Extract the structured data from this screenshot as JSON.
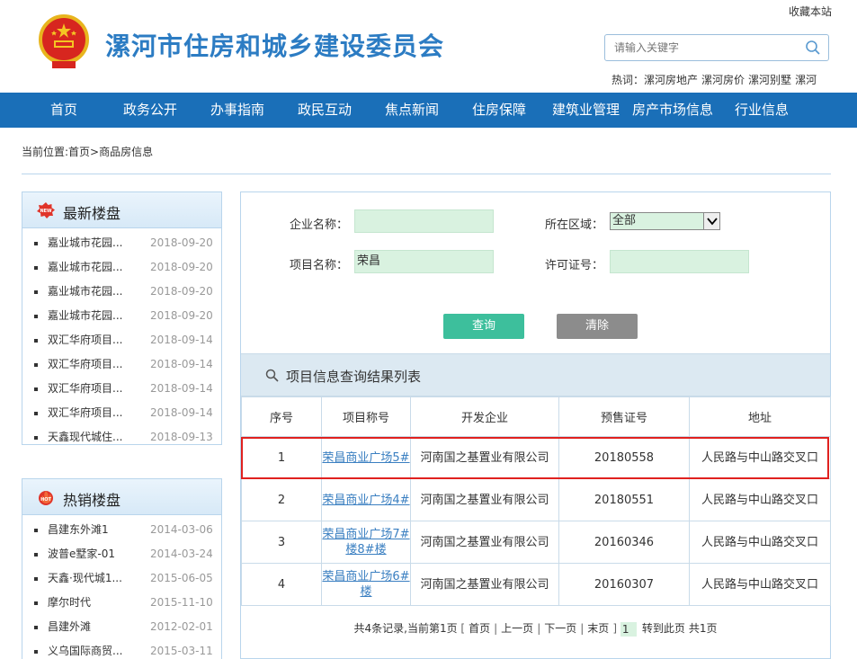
{
  "header": {
    "favorite_label": "收藏本站",
    "site_title": "漯河市住房和城乡建设委员会",
    "search_placeholder": "请输入关键字",
    "hot_label": "热词：",
    "hot_words": [
      "漯河房地产",
      "漯河房价",
      "漯河别墅",
      "漯河"
    ]
  },
  "nav": {
    "items": [
      "首页",
      "政务公开",
      "办事指南",
      "政民互动",
      "焦点新闻",
      "住房保障",
      "建筑业管理",
      "房产市场信息",
      "行业信息"
    ]
  },
  "breadcrumb": "当前位置:首页>商品房信息",
  "sidebar": {
    "latest": {
      "title": "最新楼盘",
      "badge": "NEW",
      "items": [
        {
          "name": "嘉业城市花园...",
          "date": "2018-09-20"
        },
        {
          "name": "嘉业城市花园...",
          "date": "2018-09-20"
        },
        {
          "name": "嘉业城市花园...",
          "date": "2018-09-20"
        },
        {
          "name": "嘉业城市花园...",
          "date": "2018-09-20"
        },
        {
          "name": "双汇华府项目...",
          "date": "2018-09-14"
        },
        {
          "name": "双汇华府项目...",
          "date": "2018-09-14"
        },
        {
          "name": "双汇华府项目...",
          "date": "2018-09-14"
        },
        {
          "name": "双汇华府项目...",
          "date": "2018-09-14"
        },
        {
          "name": "天鑫现代城住...",
          "date": "2018-09-13"
        }
      ]
    },
    "hot": {
      "title": "热销楼盘",
      "badge": "HOT",
      "items": [
        {
          "name": "昌建东外滩1",
          "date": "2014-03-06"
        },
        {
          "name": "波普e墅家-01",
          "date": "2014-03-24"
        },
        {
          "name": "天鑫·现代城1...",
          "date": "2015-06-05"
        },
        {
          "name": "摩尔时代",
          "date": "2015-11-10"
        },
        {
          "name": "昌建外滩",
          "date": "2012-02-01"
        },
        {
          "name": "义乌国际商贸...",
          "date": "2015-03-11"
        }
      ]
    }
  },
  "form": {
    "company_label": "企业名称：",
    "company_value": "",
    "region_label": "所在区域：",
    "region_value": "全部",
    "project_label": "项目名称：",
    "project_value": "荣昌",
    "license_label": "许可证号：",
    "license_value": "",
    "query_button": "查询",
    "clear_button": "清除"
  },
  "results": {
    "title": "项目信息查询结果列表",
    "columns": [
      "序号",
      "项目称号",
      "开发企业",
      "预售证号",
      "地址"
    ],
    "rows": [
      {
        "no": "1",
        "project_l1": "荣昌商业广场5#",
        "project_l2": "",
        "company": "河南国之基置业有限公司",
        "license": "20180558",
        "address": "人民路与中山路交叉口"
      },
      {
        "no": "2",
        "project_l1": "荣昌商业广场4#",
        "project_l2": "",
        "company": "河南国之基置业有限公司",
        "license": "20180551",
        "address": "人民路与中山路交叉口"
      },
      {
        "no": "3",
        "project_l1": "荣昌商业广场7#",
        "project_l2": "楼8#楼",
        "company": "河南国之基置业有限公司",
        "license": "20160346",
        "address": "人民路与中山路交叉口"
      },
      {
        "no": "4",
        "project_l1": "荣昌商业广场6#",
        "project_l2": "楼",
        "company": "河南国之基置业有限公司",
        "license": "20160307",
        "address": "人民路与中山路交叉口"
      }
    ]
  },
  "pager": {
    "summary": "共4条记录,当前第1页",
    "first": "首页",
    "prev": "上一页",
    "next": "下一页",
    "last": "末页",
    "page_input": "1",
    "goto": "转到此页",
    "total": "共1页"
  },
  "colors": {
    "brand_blue": "#1a6fb8",
    "title_blue": "#2c7cc3",
    "query_green": "#3dbf9c",
    "highlight_red": "#e0211f"
  }
}
